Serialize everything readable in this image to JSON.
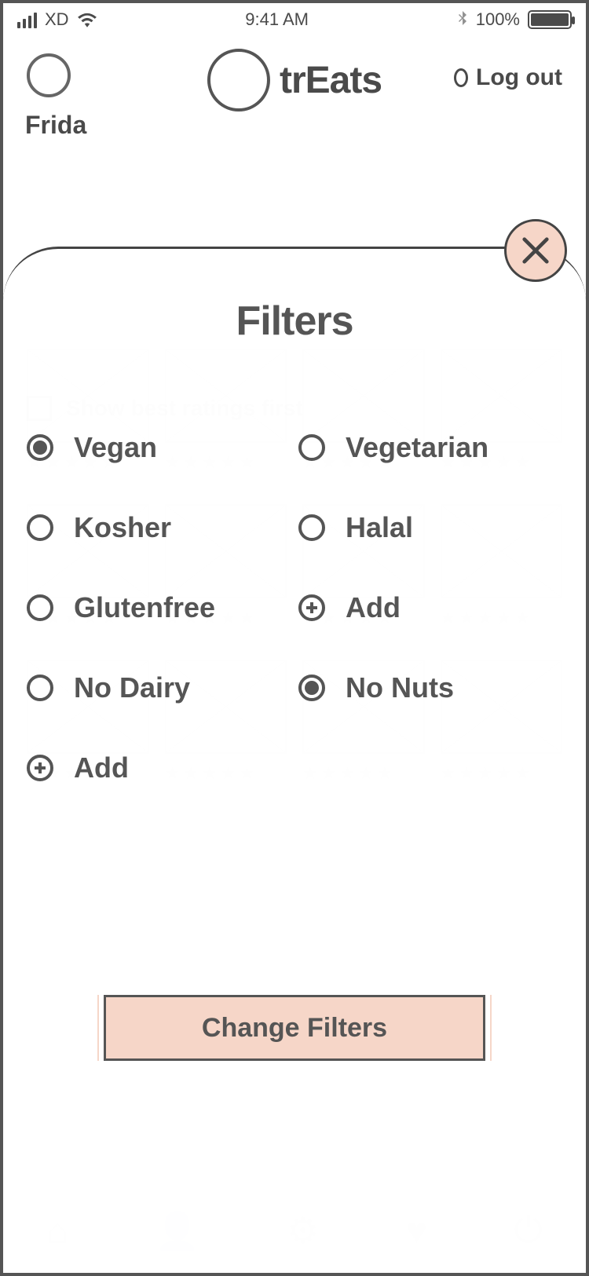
{
  "status": {
    "carrier": "XD",
    "time": "9:41 AM",
    "battery_pct": "100%"
  },
  "header": {
    "avatar_name": "Frida",
    "brand": "trEats",
    "logout_label": "Log out"
  },
  "background": {
    "sort_label": "Show best ratings first"
  },
  "sheet": {
    "title": "Filters",
    "options": [
      {
        "label": "Vegan",
        "type": "radio",
        "selected": true
      },
      {
        "label": "Vegetarian",
        "type": "radio",
        "selected": false
      },
      {
        "label": "Kosher",
        "type": "radio",
        "selected": false
      },
      {
        "label": "Halal",
        "type": "radio",
        "selected": false
      },
      {
        "label": "Glutenfree",
        "type": "radio",
        "selected": false
      },
      {
        "label": "Add",
        "type": "add",
        "selected": false
      },
      {
        "label": "No Dairy",
        "type": "radio",
        "selected": false
      },
      {
        "label": "No Nuts",
        "type": "radio",
        "selected": true
      },
      {
        "label": "Add",
        "type": "add",
        "selected": false
      }
    ],
    "apply_label": "Change Filters"
  },
  "colors": {
    "accent": "#f6d6c8",
    "ink": "#555555"
  }
}
